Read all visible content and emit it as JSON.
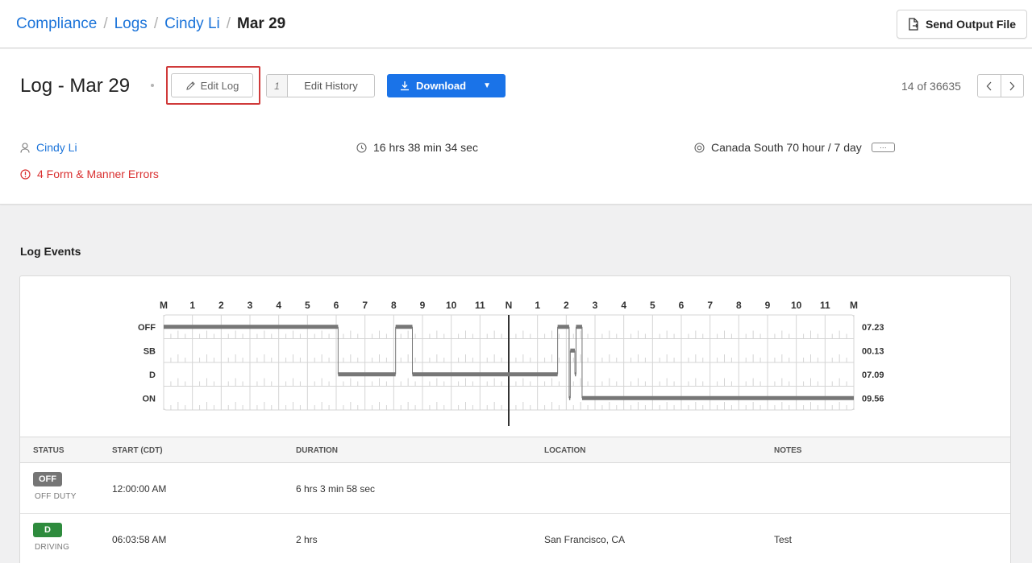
{
  "breadcrumb": {
    "items": [
      "Compliance",
      "Logs",
      "Cindy Li"
    ],
    "current": "Mar 29"
  },
  "toolbar": {
    "send_output_label": "Send Output File"
  },
  "log": {
    "title": "Log - Mar 29",
    "edit_label": "Edit Log",
    "history_count": "1",
    "history_label": "Edit History",
    "download_label": "Download",
    "pager_text": "14 of 36635"
  },
  "meta": {
    "driver": "Cindy Li",
    "duration": "16 hrs 38 min 34 sec",
    "cycle": "Canada South 70 hour / 7 day",
    "cycle_more": "···",
    "errors": "4 Form & Manner Errors"
  },
  "colors": {
    "accent": "#1a73e8",
    "error": "#d93030",
    "off": "#757575",
    "driving": "#2e8b3d"
  },
  "section": {
    "title": "Log Events"
  },
  "chart_data": {
    "type": "timeline",
    "hour_labels": [
      "M",
      "1",
      "2",
      "3",
      "4",
      "5",
      "6",
      "7",
      "8",
      "9",
      "10",
      "11",
      "N",
      "1",
      "2",
      "3",
      "4",
      "5",
      "6",
      "7",
      "8",
      "9",
      "10",
      "11",
      "M"
    ],
    "rows": [
      "OFF",
      "SB",
      "D",
      "ON"
    ],
    "totals": [
      "07.23",
      "00.13",
      "07.09",
      "09.56"
    ],
    "segments": [
      {
        "status": "OFF",
        "start": 0,
        "end": 6.066
      },
      {
        "status": "D",
        "start": 6.066,
        "end": 8.066
      },
      {
        "status": "OFF",
        "start": 8.066,
        "end": 8.65
      },
      {
        "status": "D",
        "start": 8.65,
        "end": 13.7
      },
      {
        "status": "OFF",
        "start": 13.7,
        "end": 14.1
      },
      {
        "status": "ON",
        "start": 14.1,
        "end": 14.14
      },
      {
        "status": "SB",
        "start": 14.14,
        "end": 14.3
      },
      {
        "status": "D",
        "start": 14.3,
        "end": 14.34
      },
      {
        "status": "OFF",
        "start": 14.34,
        "end": 14.55
      },
      {
        "status": "ON",
        "start": 14.55,
        "end": 24
      }
    ]
  },
  "table": {
    "headers": [
      "STATUS",
      "START (CDT)",
      "DURATION",
      "LOCATION",
      "NOTES"
    ],
    "rows": [
      {
        "badge": "OFF",
        "status_label": "OFF DUTY",
        "start": "12:00:00 AM",
        "duration": "6 hrs 3 min 58 sec",
        "location": "",
        "notes": ""
      },
      {
        "badge": "D",
        "status_label": "DRIVING",
        "start": "06:03:58 AM",
        "duration": "2 hrs",
        "location": "San Francisco, CA",
        "notes": "Test"
      }
    ]
  }
}
